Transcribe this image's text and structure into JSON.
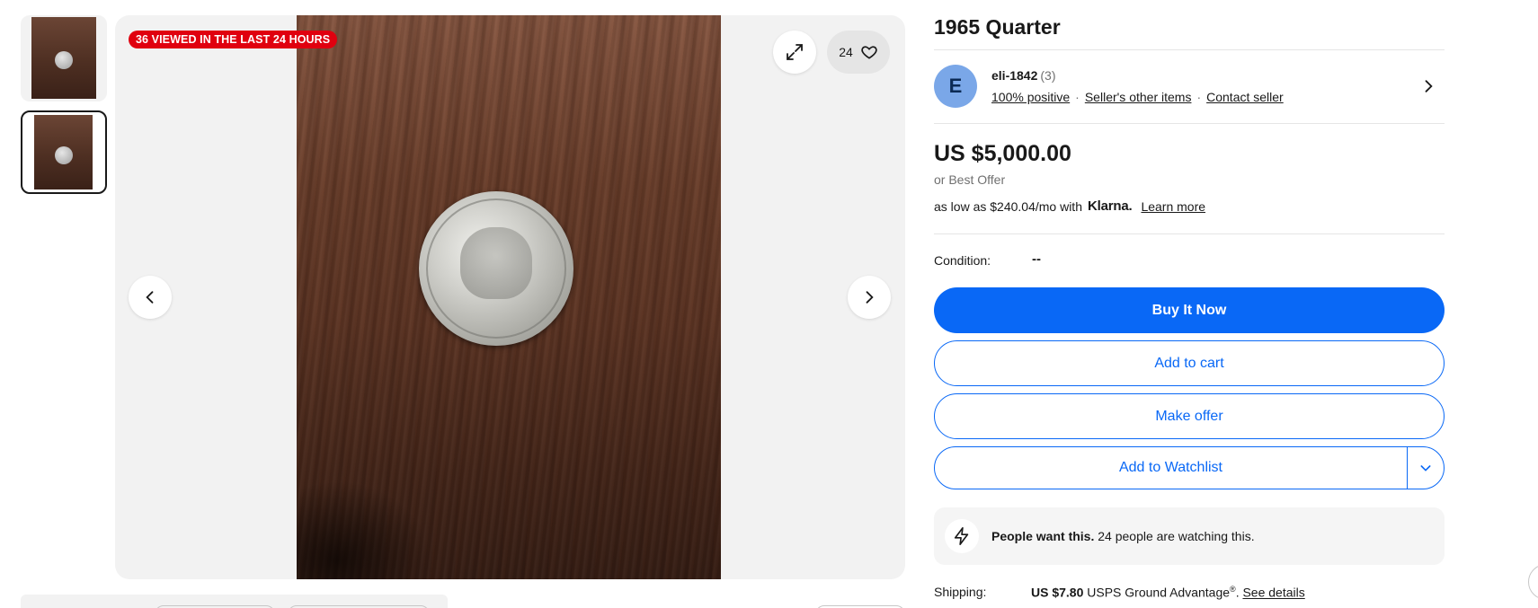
{
  "gallery": {
    "viewed_badge": "36 VIEWED IN THE LAST 24 HOURS",
    "watch_count": "24",
    "icons": {
      "expand": "expand-icon",
      "heart": "heart-icon",
      "prev": "chevron-left-icon",
      "next": "chevron-right-icon"
    }
  },
  "listing": {
    "title": "1965 Quarter",
    "seller": {
      "avatar_letter": "E",
      "name": "eli-1842",
      "feedback_count": "(3)",
      "positive": "100% positive",
      "other_items": "Seller's other items",
      "contact": "Contact seller"
    },
    "price": "US $5,000.00",
    "best_offer": "or Best Offer",
    "klarna": {
      "prefix": "as low as $240.04/mo with",
      "logo": "Klarna.",
      "learn_more": "Learn more"
    },
    "condition": {
      "label": "Condition:",
      "value": "--"
    },
    "buttons": {
      "buy": "Buy It Now",
      "cart": "Add to cart",
      "offer": "Make offer",
      "watchlist": "Add to Watchlist"
    },
    "people": {
      "bold": "People want this.",
      "text": " 24 people are watching this."
    },
    "shipping": {
      "label": "Shipping:",
      "price": "US $7.80",
      "service": " USPS Ground Advantage",
      "reg": "®",
      "period": ". ",
      "details": "See details"
    }
  },
  "colors": {
    "accent_blue": "#0968f6",
    "badge_red": "#e0000f",
    "avatar_bg": "#7aa7e8"
  }
}
